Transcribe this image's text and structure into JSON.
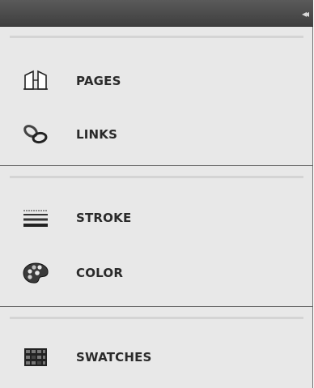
{
  "panel": {
    "collapse_glyph": "◂◂",
    "groups": [
      {
        "items": [
          {
            "label": "PAGES",
            "icon": "pages-icon"
          },
          {
            "label": "LINKS",
            "icon": "links-icon"
          }
        ]
      },
      {
        "items": [
          {
            "label": "STROKE",
            "icon": "stroke-icon"
          },
          {
            "label": "COLOR",
            "icon": "color-palette-icon"
          }
        ]
      },
      {
        "items": [
          {
            "label": "SWATCHES",
            "icon": "swatches-icon"
          }
        ]
      }
    ]
  },
  "colors": {
    "titlebar": "#4a4a4a",
    "panel_bg": "#e8e8e8",
    "label_text": "#2a2a2a"
  }
}
